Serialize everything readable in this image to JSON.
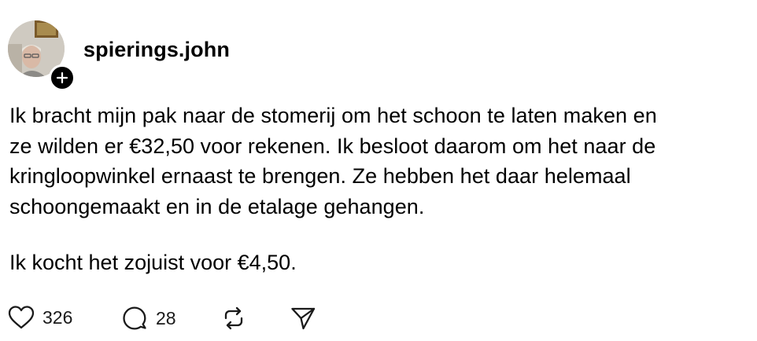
{
  "post": {
    "username": "spierings.john",
    "avatar_icon": "profile-photo",
    "follow_icon": "plus-icon",
    "body_lines": [
      "Ik bracht mijn pak naar de stomerij om het schoon te laten maken en",
      "ze wilden er €32,50 voor rekenen. Ik besloot daarom om het naar de",
      "kringloopwinkel ernaast te brengen. Ze hebben het daar helemaal",
      "schoongemaakt en in de etalage gehangen."
    ],
    "second_paragraph": "Ik kocht het zojuist voor €4,50.",
    "actions": {
      "likes": "326",
      "replies": "28",
      "like_icon": "heart-icon",
      "reply_icon": "comment-icon",
      "repost_icon": "repost-icon",
      "share_icon": "send-icon"
    }
  },
  "colors": {
    "text": "#000000",
    "badge": "#000000"
  }
}
